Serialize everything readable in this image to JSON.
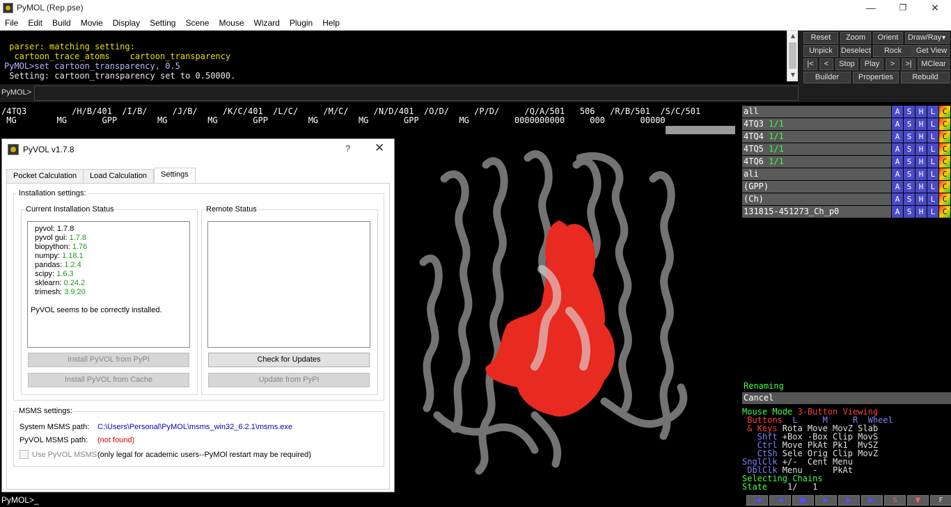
{
  "window": {
    "title": "PyMOL (Rep.pse)"
  },
  "menu": [
    "File",
    "Edit",
    "Build",
    "Movie",
    "Display",
    "Setting",
    "Scene",
    "Mouse",
    "Wizard",
    "Plugin",
    "Help"
  ],
  "console": {
    "lines": [
      " parser: matching setting:",
      "  cartoon_trace_atoms    cartoon_transparency",
      "PyMOL>set cartoon_transparency, 0.5",
      " Setting: cartoon_transparency set to 0.50000."
    ]
  },
  "buttons": {
    "row1": [
      "Reset",
      "Zoom",
      "Orient",
      "Draw/Ray"
    ],
    "row2": [
      "Unpick",
      "Deselect",
      "Rock",
      "Get View"
    ],
    "row3": [
      "|<",
      "<",
      "Stop",
      "Play",
      ">",
      ">|",
      "MClear"
    ],
    "row4": [
      "Builder",
      "Properties",
      "Rebuild"
    ]
  },
  "cmd_label": "PyMOL>",
  "sequence": {
    "row1": "/4TQ3         /H/B/401  /I/B/     /J/B/     /K/C/401  /L/C/     /M/C/     /N/D/401  /O/D/     /P/D/     /Q/A/501   506   /R/B/501  /S/C/501",
    "row2": " MG        MG       GPP        MG        MG       GPP        MG        MG       GPP        MG         0000000000     000       00000"
  },
  "objects": [
    {
      "name": "all",
      "count": ""
    },
    {
      "name": "4TQ3",
      "count": "1/1"
    },
    {
      "name": "4TQ4",
      "count": "1/1"
    },
    {
      "name": "4TQ5",
      "count": "1/1"
    },
    {
      "name": "4TQ6",
      "count": "1/1"
    },
    {
      "name": "ali",
      "count": ""
    },
    {
      "name": "(GPP)",
      "count": ""
    },
    {
      "name": "(Ch)",
      "count": ""
    },
    {
      "name": "131815-451273_Ch_p0",
      "count": ""
    }
  ],
  "obj_buttons": [
    "A",
    "S",
    "H",
    "L",
    "C"
  ],
  "renaming": "Renaming",
  "cancel": "Cancel",
  "mouse": {
    "title1": "Mouse Mode ",
    "title2": "3-Button Viewing",
    "buttons_label": " Buttons",
    "buttons_cols": "  L     M     R  Wheel",
    "keys_label": " & Keys",
    "keys_vals": " Rota Move MovZ Slab",
    "shft_label": "   Shft",
    "shft_vals": " +Box -Box Clip MovS",
    "ctrl_label": "   Ctrl",
    "ctrl_vals": " Move PkAt Pk1  MvSZ",
    "ctsh_label": "   CtSh",
    "ctsh_vals": " Sele Orig Clip MovZ",
    "sngl_label": "SnglClk",
    "sngl_vals": " +/-  Cent Menu",
    "dbl_label": " DblClk",
    "dbl_vals": " Menu  -   PkAt",
    "selecting": "Selecting Chains",
    "state_label": "State",
    "state_vals": "    1/   1"
  },
  "bottom_cmd": "PyMOL>_",
  "ctrl": [
    "|◀",
    "◀",
    "■",
    "▶",
    "▶",
    "▶|",
    "S",
    "▼",
    "F"
  ],
  "dialog": {
    "title": "PyVOL v1.7.8",
    "help": "?",
    "close": "✕",
    "tabs": [
      "Pocket Calculation",
      "Load Calculation",
      "Settings"
    ],
    "install_settings": "Installation settings:",
    "current_status": "Current Installation Status",
    "remote_status": "Remote Status",
    "versions": [
      {
        "k": "pyvol:",
        "v": "1.7.8",
        "green": false
      },
      {
        "k": "pyvol gui:",
        "v": "1.7.8",
        "green": true
      },
      {
        "k": "biopython:",
        "v": "1.76",
        "green": true
      },
      {
        "k": "numpy:",
        "v": "1.18.1",
        "green": true
      },
      {
        "k": "pandas:",
        "v": "1.2.4",
        "green": true
      },
      {
        "k": "scipy:",
        "v": "1.6.3",
        "green": true
      },
      {
        "k": "sklearn:",
        "v": "0.24.2",
        "green": true
      },
      {
        "k": "trimesh:",
        "v": "3.9.20",
        "green": true
      }
    ],
    "installed_msg": "PyVOL seems to be correctly installed.",
    "btn_install_pypi": "Install PyVOL from PyPI",
    "btn_install_cache": "Install PyVOL from Cache",
    "btn_check": "Check for Updates",
    "btn_update": "Update from PyPI",
    "msms_settings": "MSMS settings:",
    "system_msms_label": "System MSMS path:",
    "system_msms_value": "C:\\Users\\Personal\\PyMOL\\msms_win32_6.2.1\\msms.exe",
    "pyvol_msms_label": "PyVOL MSMS path:",
    "pyvol_msms_value": "(not found)",
    "use_msms": "Use PyVOL MSMS",
    "use_msms_note": "(only legal for academic users--PyMOl restart may be required)"
  }
}
